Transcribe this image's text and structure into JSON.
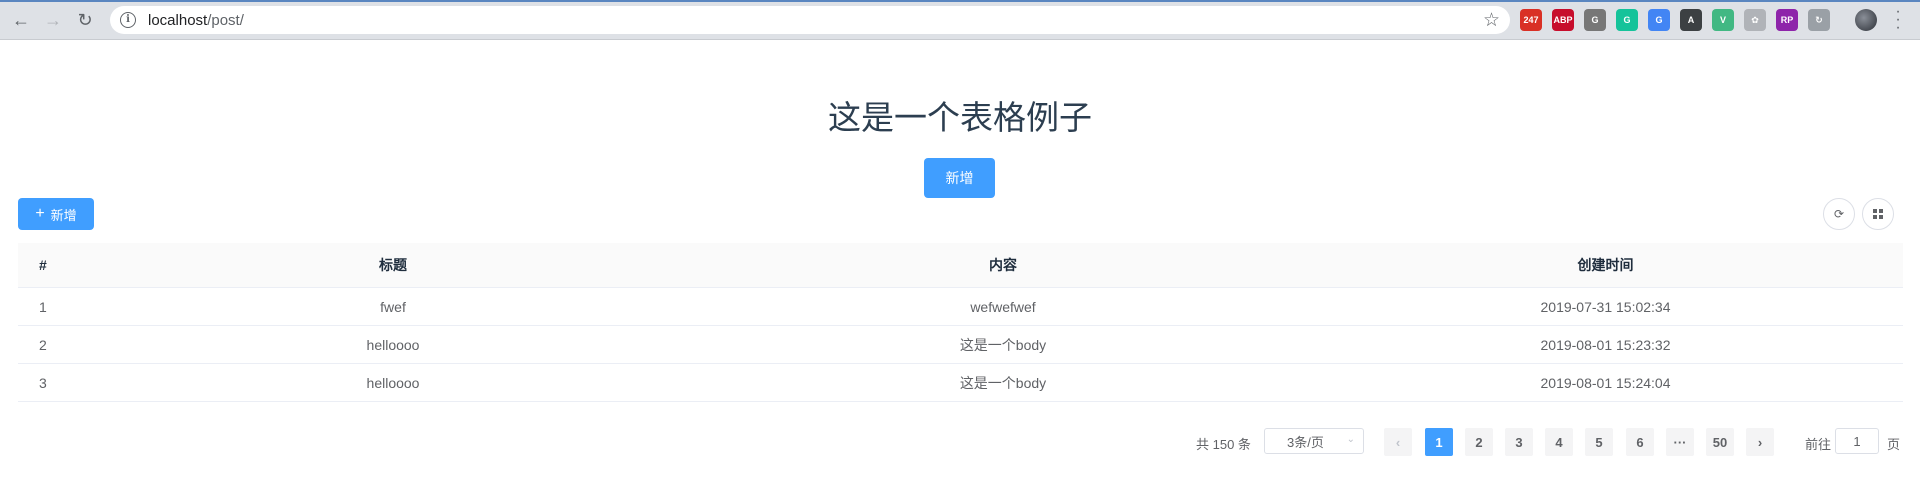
{
  "browser": {
    "url_host": "localhost",
    "url_path": "/post/",
    "extensions": [
      {
        "name": "gmail-247-extension",
        "label": "247",
        "color": "#d93025"
      },
      {
        "name": "adblock-plus-extension",
        "label": "ABP",
        "color": "#c70d2c"
      },
      {
        "name": "grammar-extension",
        "label": "G",
        "color": "#777777"
      },
      {
        "name": "grammarly-extension",
        "label": "G",
        "color": "#15c39a"
      },
      {
        "name": "translate-extension",
        "label": "G",
        "color": "#4285f4"
      },
      {
        "name": "a-extension",
        "label": "A",
        "color": "#3c4043"
      },
      {
        "name": "vue-devtools-extension",
        "label": "V",
        "color": "#41b883"
      },
      {
        "name": "generic-extension",
        "label": "✿",
        "color": "#b0b3b8"
      },
      {
        "name": "rp-extension",
        "label": "RP",
        "color": "#8e24aa"
      },
      {
        "name": "sync-extension",
        "label": "↻",
        "color": "#9aa0a6"
      }
    ]
  },
  "page": {
    "title": "这是一个表格例子",
    "center_button_label": "新增",
    "add_button_label": "新增"
  },
  "table": {
    "columns": [
      "#",
      "标题",
      "内容",
      "创建时间"
    ],
    "rows": [
      {
        "idx": "1",
        "title": "fwef",
        "content": "wefwefwef",
        "created": "2019-07-31 15:02:34"
      },
      {
        "idx": "2",
        "title": "helloooo",
        "content": "这是一个body",
        "created": "2019-08-01 15:23:32"
      },
      {
        "idx": "3",
        "title": "helloooo",
        "content": "这是一个body",
        "created": "2019-08-01 15:24:04"
      }
    ]
  },
  "pagination": {
    "total_text": "共 150 条",
    "page_size": "3条/页",
    "pages": [
      "1",
      "2",
      "3",
      "4",
      "5",
      "6"
    ],
    "ellipsis": "···",
    "last_page": "50",
    "current_page": "1",
    "goto_label": "前往",
    "goto_value": "1",
    "goto_unit": "页"
  },
  "colors": {
    "primary": "#409eff",
    "title_text": "#2c3e50"
  }
}
